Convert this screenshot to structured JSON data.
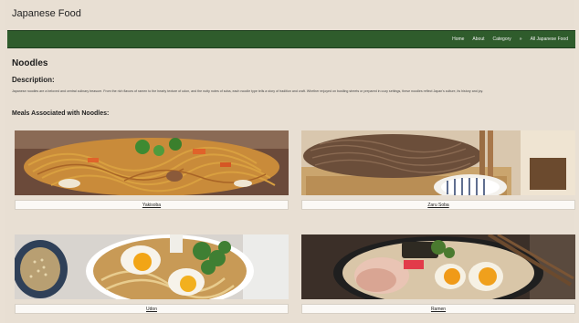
{
  "site": {
    "title": "Japanese Food"
  },
  "nav": {
    "items": [
      "Home",
      "About",
      "Category",
      "All Japanese Food"
    ],
    "separator": "»"
  },
  "main": {
    "title": "Noodles",
    "description_heading": "Description:",
    "description_text": "Japanese noodles are a beloved and central culinary treasure. From the rich flavors of ramen to the hearty texture of udon, and the nutty notes of soba, each noodle type tells a story of tradition and craft. Whether enjoyed on bustling streets or prepared in cozy settings, these noodles reflect Japan's culture, its history and joy.",
    "meals_heading": "Meals Associated with Noodles:",
    "meals": [
      {
        "label": "Yakisoba"
      },
      {
        "label": "Zaru Soba"
      },
      {
        "label": "Udon"
      },
      {
        "label": "Ramen"
      }
    ]
  },
  "colors": {
    "background": "#e8dfd3",
    "navbar": "#2f5c2c",
    "label_bg": "#fbf9f6"
  }
}
